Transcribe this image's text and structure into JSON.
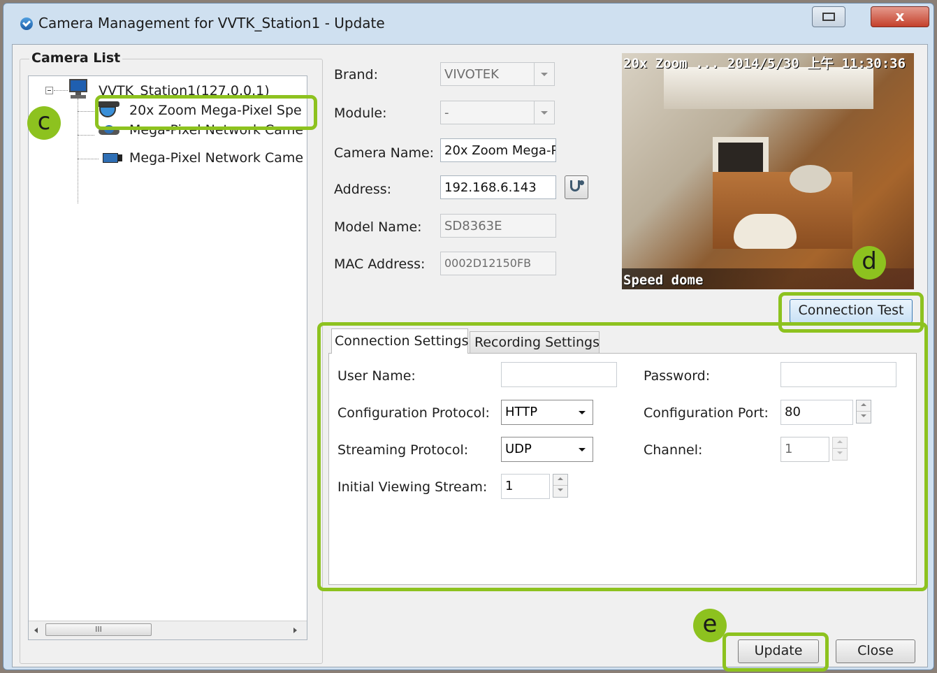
{
  "window": {
    "title": "Camera Management for VVTK_Station1 - Update",
    "close_label": "x"
  },
  "camera_list": {
    "title": "Camera List",
    "station": "VVTK_Station1(127.0.0.1)",
    "cameras": [
      "20x Zoom Mega-Pixel Spe",
      "Mega-Pixel Network Came",
      "Mega-Pixel Network Came"
    ],
    "scroll_thumb": "III"
  },
  "info": {
    "brand_label": "Brand:",
    "brand_value": "VIVOTEK",
    "module_label": "Module:",
    "module_value": "-",
    "camera_name_label": "Camera Name:",
    "camera_name_value": "20x Zoom Mega-P",
    "address_label": "Address:",
    "address_value": "192.168.6.143",
    "model_label": "Model Name:",
    "model_value": "SD8363E",
    "mac_label": "MAC Address:",
    "mac_value": "0002D12150FB"
  },
  "preview": {
    "overlay_top": "20x Zoom ... 2014/5/30 上午 11:30:36",
    "overlay_bottom": "Speed dome"
  },
  "connection_test_label": "Connection Test",
  "tabs": [
    "Connection Settings",
    "Recording Settings"
  ],
  "settings": {
    "user_name_label": "User Name:",
    "user_name_value": "",
    "password_label": "Password:",
    "password_value": "",
    "config_protocol_label": "Configuration Protocol:",
    "config_protocol_value": "HTTP",
    "config_port_label": "Configuration Port:",
    "config_port_value": "80",
    "streaming_protocol_label": "Streaming Protocol:",
    "streaming_protocol_value": "UDP",
    "channel_label": "Channel:",
    "channel_value": "1",
    "initial_stream_label": "Initial Viewing Stream:",
    "initial_stream_value": "1"
  },
  "buttons": {
    "update": "Update",
    "close": "Close"
  },
  "badges": {
    "c": "c",
    "d": "d",
    "e": "e"
  },
  "colors": {
    "highlight": "#8dc21f"
  }
}
